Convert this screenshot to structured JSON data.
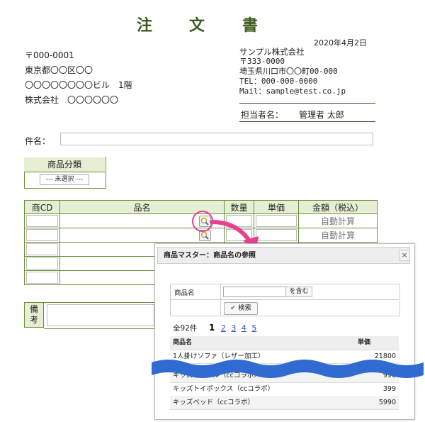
{
  "title_chars": [
    "注",
    "文",
    "書"
  ],
  "date": "2020年4月2日",
  "recipient": {
    "postal": "〒000-0001",
    "address1": "東京都〇〇区〇〇",
    "address2": "〇〇〇〇〇〇〇〇ビル　1階",
    "name": "株式会社　〇〇〇〇〇〇"
  },
  "sender": {
    "company": "サンプル株式会社",
    "postal": "〒333-0000",
    "address": "埼玉県川口市〇〇町00-000",
    "tel": "TEL：000-000-0000",
    "mail": "Mail：sample@test.co.jp",
    "rep_label": "担当者名：",
    "rep_name": "管理者 太郎"
  },
  "subject_label": "件名：",
  "category": {
    "header": "商品分類",
    "selected": "--- 未選択 ---"
  },
  "order_table": {
    "headers": [
      "商CD",
      "品名",
      "数量",
      "単価",
      "金額（税込）"
    ],
    "auto_label": "自動計算"
  },
  "remarks_label": "備考",
  "modal": {
    "title": "商品マスター：商品名の参照",
    "close": "×",
    "field_label": "商品名",
    "suffix": "を含む",
    "search_button": "検索",
    "total": "全92件",
    "pages": [
      "1",
      "2",
      "3",
      "4",
      "5"
    ],
    "col_name": "商品名",
    "col_price": "単価",
    "rows": [
      {
        "name": "1人掛けソファ（レザー加工）",
        "price": "21800"
      },
      {
        "name": "キッズテーブル（ccコラボ）",
        "price": "990"
      },
      {
        "name": "キッズトイボックス（ccコラボ）",
        "price": "399"
      },
      {
        "name": "キッズベッド（ccコラボ）",
        "price": "5990"
      }
    ]
  },
  "colors": {
    "accent": "#6b8e3a",
    "highlight": "#e8408e",
    "wave": "#2f6bd1"
  }
}
